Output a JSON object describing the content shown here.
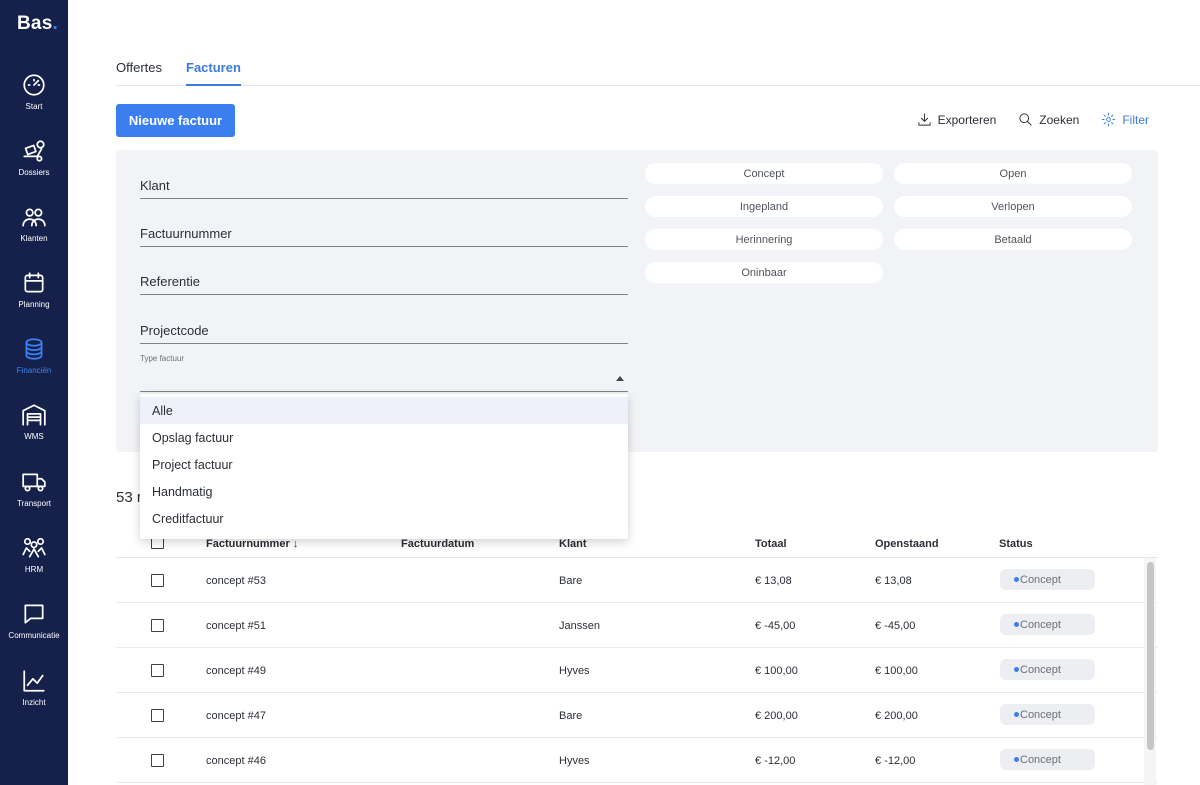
{
  "brand": {
    "name": "Bas",
    "dot": "."
  },
  "sidebar": {
    "items": [
      {
        "label": "Start",
        "icon": "speedometer-icon"
      },
      {
        "label": "Dossiers",
        "icon": "truck-loading-icon"
      },
      {
        "label": "Klanten",
        "icon": "customers-icon"
      },
      {
        "label": "Planning",
        "icon": "calendar-icon"
      },
      {
        "label": "Financiën",
        "icon": "coins-icon",
        "active": true
      },
      {
        "label": "WMS",
        "icon": "warehouse-icon"
      },
      {
        "label": "Transport",
        "icon": "truck-icon"
      },
      {
        "label": "HRM",
        "icon": "people-icon"
      },
      {
        "label": "Communicatie",
        "icon": "chat-icon"
      },
      {
        "label": "Inzicht",
        "icon": "chart-line-icon"
      }
    ]
  },
  "tabs": [
    {
      "label": "Offertes",
      "active": false
    },
    {
      "label": "Facturen",
      "active": true
    }
  ],
  "new_button": "Nieuwe factuur",
  "toolbar": {
    "export": "Exporteren",
    "search": "Zoeken",
    "filter": "Filter"
  },
  "filters": {
    "fields": [
      "Klant",
      "Factuurnummer",
      "Referentie",
      "Projectcode"
    ],
    "type_label": "Type factuur",
    "type_options": [
      "Alle",
      "Opslag factuur",
      "Project factuur",
      "Handmatig",
      "Creditfactuur"
    ],
    "status_chips": [
      "Concept",
      "Open",
      "Ingepland",
      "Verlopen",
      "Herinnering",
      "Betaald",
      "Oninbaar"
    ]
  },
  "result_count": "53 r",
  "table": {
    "headers": {
      "number": "Factuurnummer",
      "date": "Factuurdatum",
      "client": "Klant",
      "total": "Totaal",
      "open": "Openstaand",
      "status": "Status"
    },
    "rows": [
      {
        "number": "concept #53",
        "client": "Bare",
        "total": "€ 13,08",
        "open": "€ 13,08",
        "status": "Concept"
      },
      {
        "number": "concept #51",
        "client": "Janssen",
        "total": "€ -45,00",
        "open": "€ -45,00",
        "status": "Concept"
      },
      {
        "number": "concept #49",
        "client": "Hyves",
        "total": "€ 100,00",
        "open": "€ 100,00",
        "status": "Concept"
      },
      {
        "number": "concept #47",
        "client": "Bare",
        "total": "€ 200,00",
        "open": "€ 200,00",
        "status": "Concept"
      },
      {
        "number": "concept #46",
        "client": "Hyves",
        "total": "€ -12,00",
        "open": "€ -12,00",
        "status": "Concept"
      }
    ]
  },
  "colors": {
    "sidebar": "#15214a",
    "accent": "#3b7ef0",
    "panel": "#f1f3f6"
  }
}
